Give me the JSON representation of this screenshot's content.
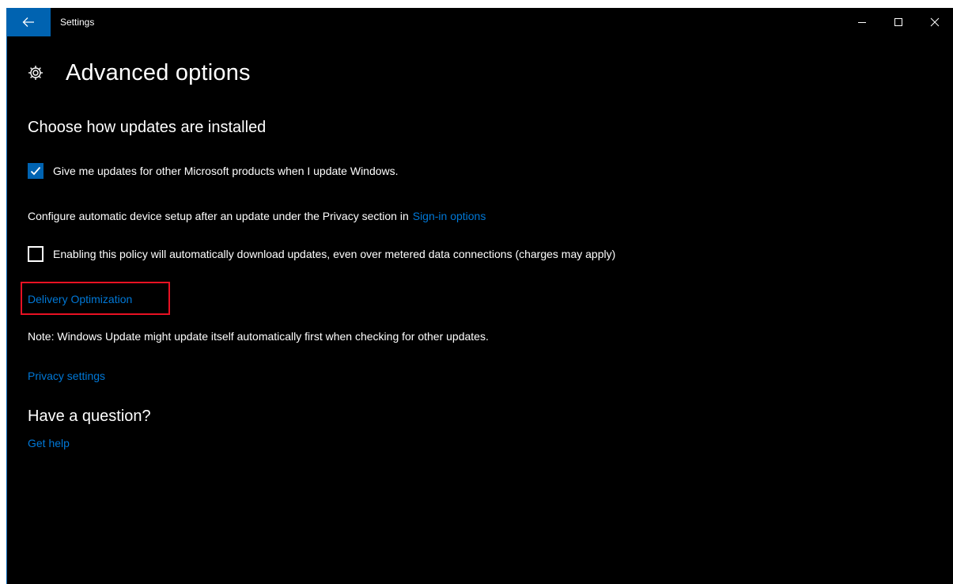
{
  "window": {
    "title": "Settings",
    "accent_color": "#0063b1",
    "link_color": "#0078d7",
    "highlight_color": "#e81123",
    "controls": {
      "back_icon": "arrow-left-icon",
      "minimize_icon": "minimize-icon",
      "maximize_icon": "maximize-icon",
      "close_icon": "close-icon"
    }
  },
  "header": {
    "icon": "gear-icon",
    "title": "Advanced options"
  },
  "updates": {
    "section_title": "Choose how updates are installed",
    "other_products_checkbox": {
      "label": "Give me updates for other Microsoft products when I update Windows.",
      "checked": true
    },
    "device_setup_text": "Configure automatic device setup after an update under the Privacy section in",
    "sign_in_options_link": "Sign-in options",
    "metered_checkbox": {
      "label": "Enabling this policy will automatically download updates, even over metered data connections (charges may apply)",
      "checked": false
    },
    "delivery_optimization_link": "Delivery Optimization",
    "note": "Note: Windows Update might update itself automatically first when checking for other updates.",
    "privacy_settings_link": "Privacy settings"
  },
  "help": {
    "title": "Have a question?",
    "get_help_link": "Get help"
  }
}
